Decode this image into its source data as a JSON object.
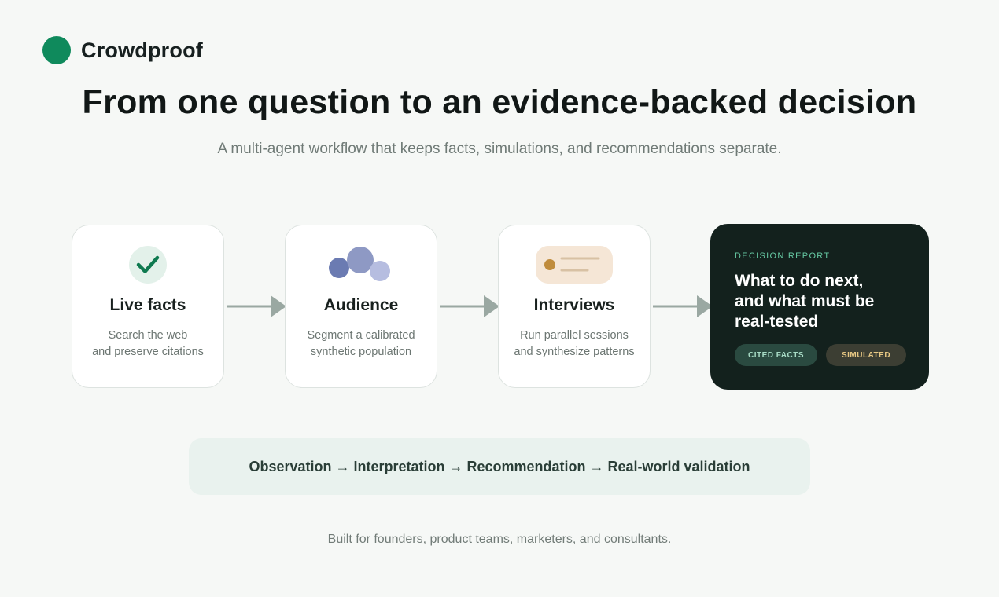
{
  "brand": {
    "name": "Crowdproof",
    "color": "#0f8a5c"
  },
  "hero": {
    "title": "From one question to an evidence-backed decision",
    "subtitle": "A multi-agent workflow that keeps facts, simulations, and recommendations separate."
  },
  "steps": [
    {
      "icon": "check-icon",
      "title": "Live facts",
      "desc_lines": [
        "Search the web",
        "and preserve citations"
      ]
    },
    {
      "icon": "audience-bubbles-icon",
      "title": "Audience",
      "desc_lines": [
        "Segment a calibrated",
        "synthetic population"
      ]
    },
    {
      "icon": "interview-chat-icon",
      "title": "Interviews",
      "desc_lines": [
        "Run parallel sessions",
        "and synthesize patterns"
      ]
    }
  ],
  "report": {
    "kicker": "DECISION REPORT",
    "title_lines": [
      "What to do next,",
      "and what must be",
      "real-tested"
    ],
    "pills": [
      {
        "label": "CITED FACTS",
        "color": "#a8dcc6"
      },
      {
        "label": "SIMULATED",
        "color": "#e7c884"
      }
    ],
    "background": "#13211d"
  },
  "chain": {
    "text": "Observation → Interpretation → Recommendation → Real-world validation"
  },
  "footer": {
    "text": "Built for founders, product teams, marketers, and consultants."
  }
}
